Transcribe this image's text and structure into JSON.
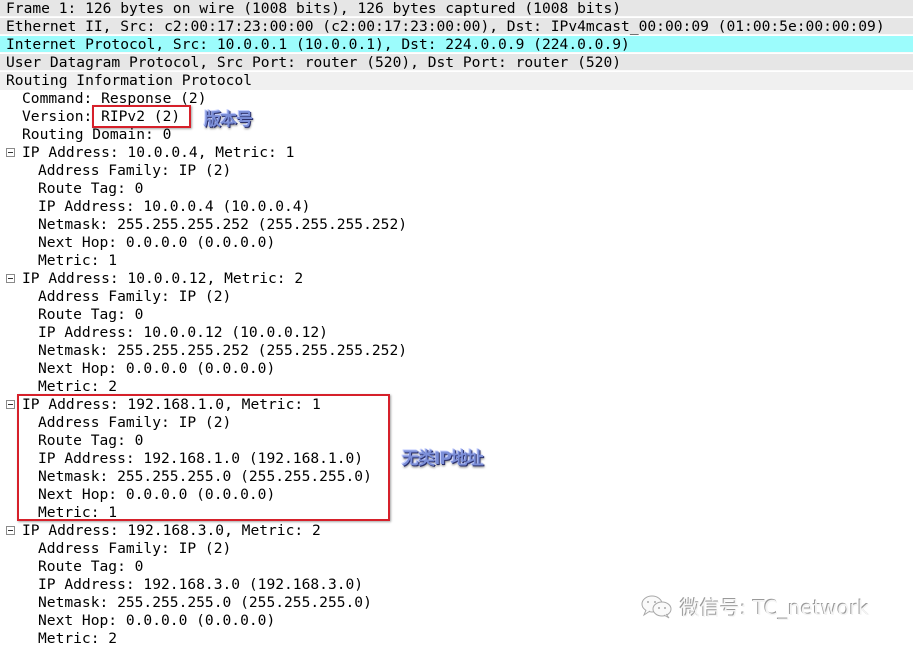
{
  "packet_tree": {
    "frame": "Frame 1: 126 bytes on wire (1008 bits), 126 bytes captured (1008 bits)",
    "ethernet": "Ethernet II, Src: c2:00:17:23:00:00 (c2:00:17:23:00:00), Dst: IPv4mcast_00:00:09 (01:00:5e:00:00:09)",
    "ip": "Internet Protocol, Src: 10.0.0.1 (10.0.0.1), Dst: 224.0.0.9 (224.0.0.9)",
    "udp": "User Datagram Protocol, Src Port: router (520), Dst Port: router (520)",
    "rip": {
      "title": "Routing Information Protocol",
      "command": "Command: Response (2)",
      "version_label": "Version: ",
      "version_value": "RIPv2 (2)",
      "routing_domain": "Routing Domain: 0",
      "entries": [
        {
          "header": "IP Address: 10.0.0.4, Metric: 1",
          "address_family": "Address Family: IP (2)",
          "route_tag": "Route Tag: 0",
          "ip_address": "IP Address: 10.0.0.4 (10.0.0.4)",
          "netmask": "Netmask: 255.255.255.252 (255.255.255.252)",
          "next_hop": "Next Hop: 0.0.0.0 (0.0.0.0)",
          "metric": "Metric: 1"
        },
        {
          "header": "IP Address: 10.0.0.12, Metric: 2",
          "address_family": "Address Family: IP (2)",
          "route_tag": "Route Tag: 0",
          "ip_address": "IP Address: 10.0.0.12 (10.0.0.12)",
          "netmask": "Netmask: 255.255.255.252 (255.255.255.252)",
          "next_hop": "Next Hop: 0.0.0.0 (0.0.0.0)",
          "metric": "Metric: 2"
        },
        {
          "header": "IP Address: 192.168.1.0, Metric: 1",
          "address_family": "Address Family: IP (2)",
          "route_tag": "Route Tag: 0",
          "ip_address": "IP Address: 192.168.1.0 (192.168.1.0)",
          "netmask": "Netmask: 255.255.255.0 (255.255.255.0)",
          "next_hop": "Next Hop: 0.0.0.0 (0.0.0.0)",
          "metric": "Metric: 1"
        },
        {
          "header": "IP Address: 192.168.3.0, Metric: 2",
          "address_family": "Address Family: IP (2)",
          "route_tag": "Route Tag: 0",
          "ip_address": "IP Address: 192.168.3.0 (192.168.3.0)",
          "netmask": "Netmask: 255.255.255.0 (255.255.255.0)",
          "next_hop": "Next Hop: 0.0.0.0 (0.0.0.0)",
          "metric": "Metric: 2"
        }
      ]
    }
  },
  "annotations": {
    "version": "版本号",
    "classless": "无类IP地址"
  },
  "watermark": {
    "icon": "wechat-icon",
    "text": "微信号: TC_network"
  },
  "colors": {
    "selected_row": "#9cfcfc",
    "header_row": "#e6e6e6",
    "highlight_box": "#d6202a",
    "annotation_text": "#7c8fd8"
  }
}
